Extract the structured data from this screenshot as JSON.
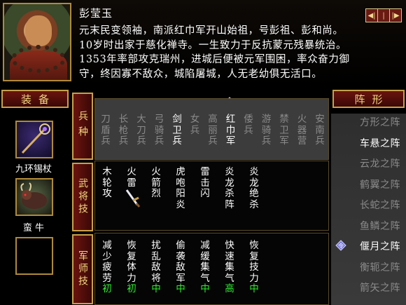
{
  "hero": {
    "name": "彭莹玉",
    "bio_lines": [
      "元末民变领袖，南派红巾军开山始祖，号彭祖、彭和尚。",
      "10岁时出家于慈化禅寺。一生致力于反抗蒙元残暴统治。",
      "1353年率部攻克瑞州，进城后便被元军围困，率众奋力御",
      "守，终因寡不敌众，城陷屠城，人无老幼俱无活口。"
    ]
  },
  "nav_buttons": [
    "◀|",
    "|",
    "|▶"
  ],
  "equipment": {
    "header": "装备",
    "items": [
      {
        "name": "九环锡杖"
      },
      {
        "name": "蛮 牛"
      },
      {
        "name": ""
      }
    ]
  },
  "sections": {
    "bing": {
      "label": "兵种",
      "columns": [
        {
          "text": "刀盾兵",
          "style": "dim"
        },
        {
          "text": "长枪兵",
          "style": "dim"
        },
        {
          "text": "大刀兵",
          "style": "dim"
        },
        {
          "text": "弓骑兵",
          "style": "dim"
        },
        {
          "text": "剑卫兵",
          "style": "bright"
        },
        {
          "text": "女兵",
          "style": "dim"
        },
        {
          "text": "高丽兵",
          "style": "dim"
        },
        {
          "text": "红巾军",
          "style": "bright"
        },
        {
          "text": "倭兵",
          "style": "dim"
        },
        {
          "text": "游骑兵",
          "style": "dim"
        },
        {
          "text": "禁卫军",
          "style": "dim"
        },
        {
          "text": "火器营",
          "style": "dim"
        },
        {
          "text": "安南兵",
          "style": "dim"
        }
      ]
    },
    "wujiang": {
      "label": "武将技",
      "columns": [
        {
          "text": "木轮攻"
        },
        {
          "text": "火雷"
        },
        {
          "text": "火箭烈"
        },
        {
          "text": "虎咆阳炎"
        },
        {
          "text": "雷击闪"
        },
        {
          "text": "炎龙杀阵"
        },
        {
          "text": "炎龙绝杀"
        }
      ]
    },
    "junshi": {
      "label": "军师技",
      "columns": [
        {
          "text": "减少疲劳",
          "level": "初"
        },
        {
          "text": "恢复体力",
          "level": "初"
        },
        {
          "text": "扰乱敌将",
          "level": "中"
        },
        {
          "text": "偷袭敌军",
          "level": "中"
        },
        {
          "text": "减缓集气",
          "level": "中"
        },
        {
          "text": "快速集气",
          "level": "高"
        },
        {
          "text": "恢复技力",
          "level": "中"
        }
      ]
    }
  },
  "formation": {
    "header": "阵形",
    "items": [
      {
        "name": "方形之阵",
        "style": "dim"
      },
      {
        "name": "车悬之阵",
        "style": "bright"
      },
      {
        "name": "云龙之阵",
        "style": "dim"
      },
      {
        "name": "鹤翼之阵",
        "style": "dim"
      },
      {
        "name": "长蛇之阵",
        "style": "dim"
      },
      {
        "name": "鱼鳞之阵",
        "style": "dim"
      },
      {
        "name": "偃月之阵",
        "style": "bright",
        "selected": true
      },
      {
        "name": "衡轭之阵",
        "style": "dim"
      },
      {
        "name": "箭矢之阵",
        "style": "dim"
      }
    ]
  },
  "colors": {
    "gold": "#c8a04a",
    "header_red": "#6a140e",
    "level_green": "#2ef02e"
  },
  "icons": {
    "command": "令"
  }
}
